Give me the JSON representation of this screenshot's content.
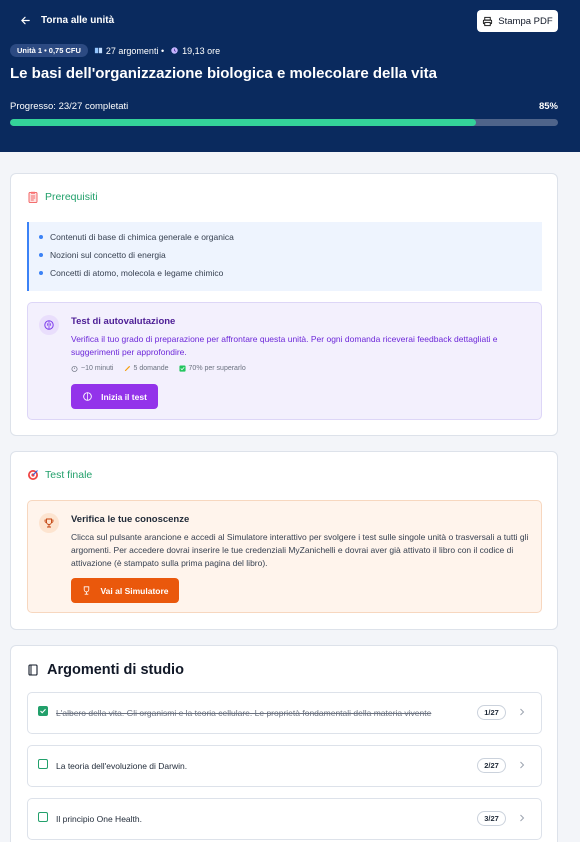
{
  "header": {
    "back_label": "Torna alle unità",
    "print_label": "Stampa PDF",
    "unit_badge": "Unità 1 • 0,75 CFU",
    "topics_count": "27 argomenti •",
    "hours": "19,13 ore",
    "title": "Le basi dell'organizzazione biologica e molecolare della vita",
    "progress_label": "Progresso: 23/27 completati",
    "progress_pct": "85%",
    "progress_value": 85
  },
  "prereq": {
    "heading": "Prerequisiti",
    "items": [
      "Contenuti di base di chimica generale e organica",
      "Nozioni sul concetto di energia",
      "Concetti di atomo, molecola e legame chimico"
    ]
  },
  "selftest": {
    "title": "Test di autovalutazione",
    "description": "Verifica il tuo grado di preparazione per affrontare questa unità. Per ogni domanda riceverai feedback dettagliati e suggerimenti per approfondire.",
    "duration": "~10 minuti",
    "questions": "5 domande",
    "pass": "70% per superarlo",
    "button": "Inizia il test"
  },
  "finaltest": {
    "heading": "Test finale",
    "title": "Verifica le tue conoscenze",
    "description": "Clicca sul pulsante arancione e accedi al Simulatore interattivo per svolgere i test sulle singole unità o trasversali a tutti gli argomenti. Per accedere dovrai inserire le tue credenziali MyZanichelli e dovrai aver già attivato il libro con il codice di attivazione (è stampato sulla prima pagina del libro).",
    "button": "Vai al Simulatore"
  },
  "topics": {
    "heading": "Argomenti di studio",
    "items": [
      {
        "label": "L'albero della vita. Gli organismi e la teoria cellulare. Le proprietà fondamentali della materia vivente",
        "count": "1/27",
        "done": true
      },
      {
        "label": "La teoria dell'evoluzione di Darwin.",
        "count": "2/27",
        "done": false
      },
      {
        "label": "Il principio One Health.",
        "count": "3/27",
        "done": false
      }
    ]
  },
  "colors": {
    "header_bg": "#0a2a5e",
    "accent_green": "#22a06b",
    "progress_fill": "#34d399",
    "purple_button": "#9333ea",
    "orange_button": "#ea580c"
  },
  "icons": [
    "arrow-left-icon",
    "printer-icon",
    "book-icon",
    "clock-icon",
    "clipboard-icon",
    "brain-icon",
    "timer-icon",
    "pencil-icon",
    "check-square-icon",
    "target-icon",
    "trophy-icon",
    "chevron-right-icon"
  ]
}
